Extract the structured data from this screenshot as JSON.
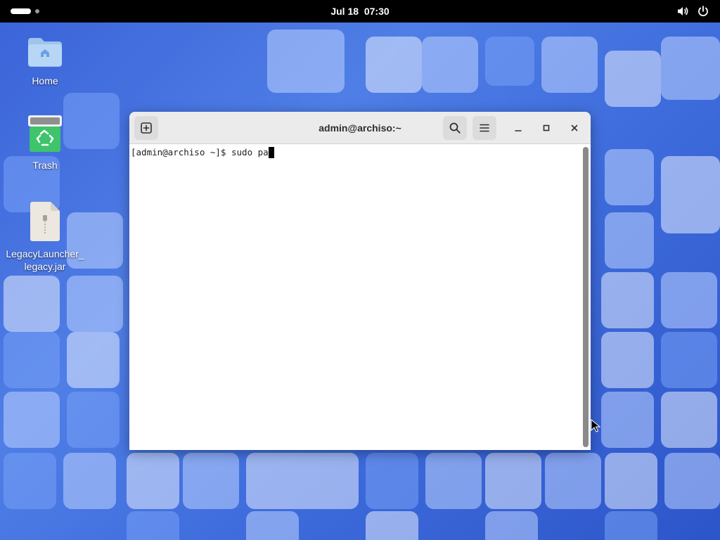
{
  "topbar": {
    "date": "Jul 18",
    "time": "07:30",
    "icons": {
      "volume": "volume-icon",
      "power": "power-icon"
    }
  },
  "desktop": {
    "icons": [
      {
        "label": "Home",
        "icon": "home-folder-icon"
      },
      {
        "label": "Trash",
        "icon": "trash-icon"
      },
      {
        "label": "LegacyLauncher_\nlegacy.jar",
        "label_line1": "LegacyLauncher_",
        "label_line2": "legacy.jar",
        "icon": "jar-file-icon"
      }
    ]
  },
  "terminal": {
    "title": "admin@archiso:~",
    "prompt": "[admin@archiso ~]$ ",
    "input": "sudo pa",
    "buttons": {
      "new_tab": "new-tab-icon",
      "search": "search-icon",
      "menu": "hamburger-menu-icon",
      "minimize": "minimize-icon",
      "maximize": "maximize-icon",
      "close": "close-icon"
    }
  },
  "colors": {
    "topbar": "#000000",
    "wallpaper": "#3f6ddd",
    "headerbar": "#ebebeb",
    "terminal_bg": "#ffffff",
    "terminal_fg": "#1e1e1e"
  }
}
